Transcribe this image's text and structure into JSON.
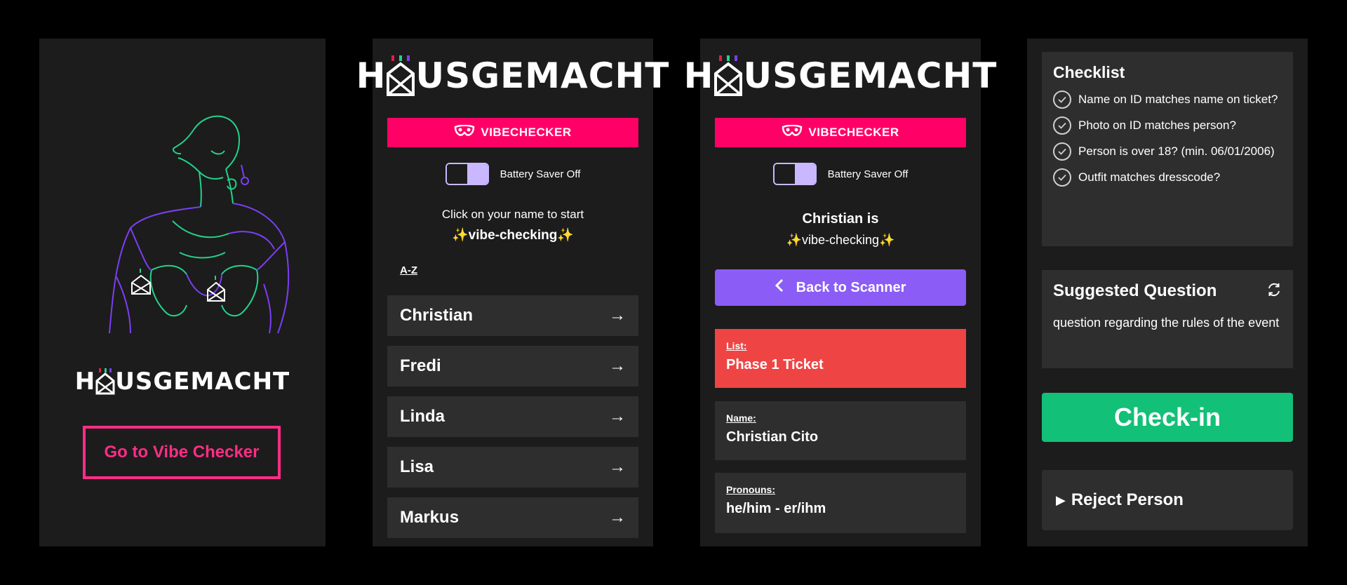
{
  "brand": {
    "logo_text": "HAUSGEMACHT",
    "logo_prefix": "H",
    "logo_suffix": "USGEMACHT",
    "pink": "#ff0066",
    "purple": "#8b5cf6",
    "green": "#12c077",
    "red": "#ef4444"
  },
  "screen1": {
    "illustration_icon": "neon-figure-illustration",
    "goto_label": "Go to Vibe Checker"
  },
  "vibechecker": {
    "bar_label": "VIBECHECKER",
    "mask_icon": "mask-icon",
    "toggle_label": "Battery Saver Off"
  },
  "screen2": {
    "intro_line1": "Click on your name to start",
    "intro_line2": "✨vibe-checking✨",
    "sort_label": "A-Z",
    "names": [
      "Christian",
      "Fredi",
      "Linda",
      "Lisa",
      "Markus"
    ],
    "arrow_glyph": "→"
  },
  "screen3": {
    "intro_line1": "Christian is",
    "intro_line2": "✨vibe-checking✨",
    "back_label": "Back to Scanner",
    "list_label": "List:",
    "list_value": "Phase 1 Ticket",
    "name_label": "Name:",
    "name_value": "Christian Cito",
    "pronouns_label": "Pronouns:",
    "pronouns_value": "he/him - er/ihm"
  },
  "screen4": {
    "checklist_title": "Checklist",
    "checklist_items": [
      "Name on ID matches name on ticket?",
      "Photo on ID matches person?",
      "Person is over 18? (min. 06/01/2006)",
      "Outfit matches dresscode?"
    ],
    "question_title": "Suggested Question",
    "question_text": "question regarding the rules of the event",
    "checkin_label": "Check-in",
    "reject_label": "Reject Person"
  }
}
